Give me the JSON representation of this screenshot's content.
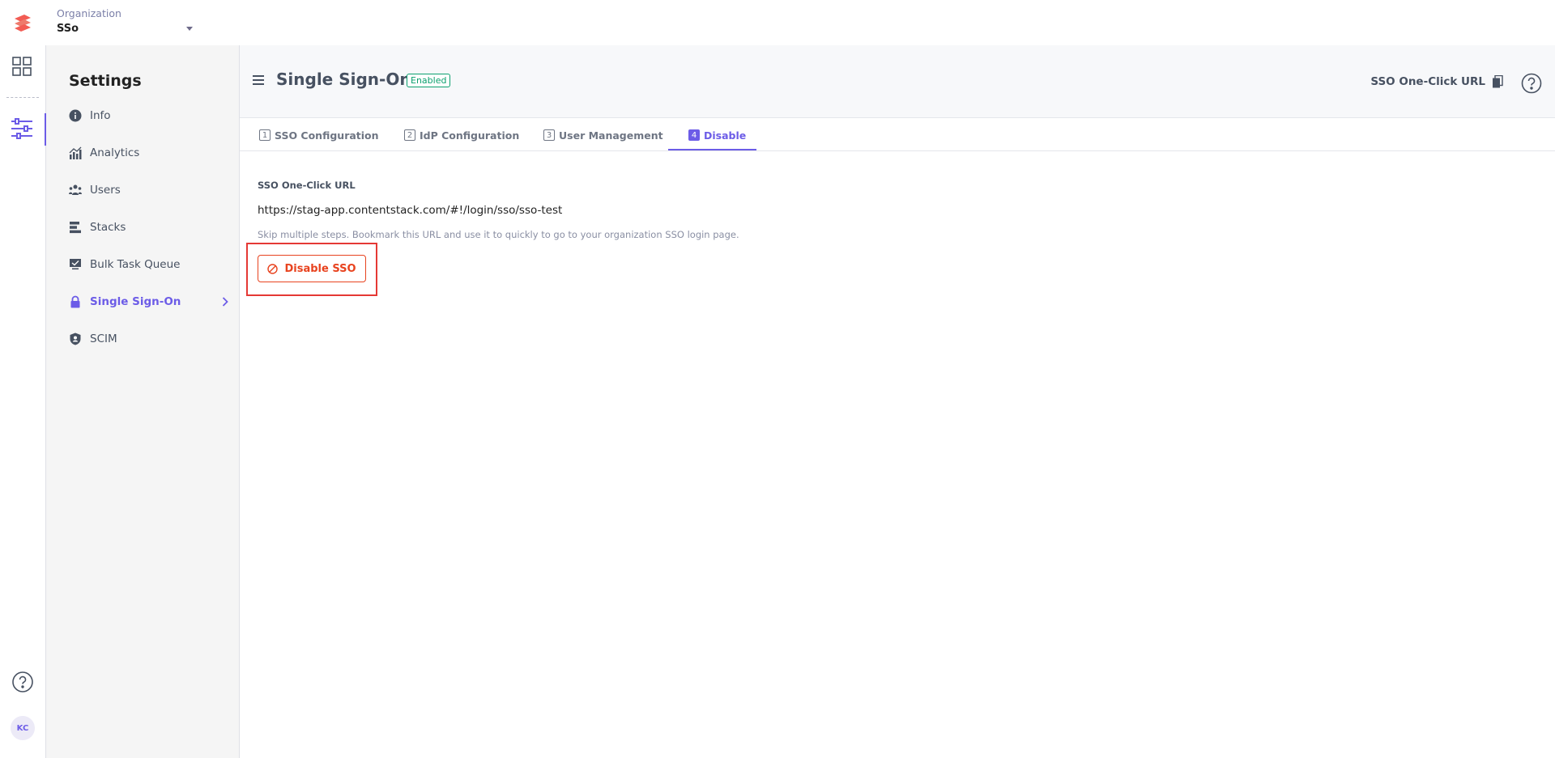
{
  "header": {
    "org_label": "Organization",
    "org_name": "SSo"
  },
  "rail": {
    "avatar_initials": "KC"
  },
  "sidebar": {
    "title": "Settings",
    "items": [
      {
        "label": "Info",
        "icon": "info-icon"
      },
      {
        "label": "Analytics",
        "icon": "analytics-icon"
      },
      {
        "label": "Users",
        "icon": "users-icon"
      },
      {
        "label": "Stacks",
        "icon": "stacks-icon"
      },
      {
        "label": "Bulk Task Queue",
        "icon": "bulk-task-icon"
      },
      {
        "label": "Single Sign-On",
        "icon": "lock-icon",
        "active": true
      },
      {
        "label": "SCIM",
        "icon": "shield-icon"
      }
    ]
  },
  "main": {
    "title": "Single Sign-On",
    "status_badge": "Enabled",
    "oneclick_link": "SSO One-Click URL",
    "tabs": [
      {
        "num": "1",
        "label": "SSO Configuration"
      },
      {
        "num": "2",
        "label": "IdP Configuration"
      },
      {
        "num": "3",
        "label": "User Management"
      },
      {
        "num": "4",
        "label": "Disable",
        "active": true
      }
    ],
    "section_label": "SSO One-Click URL",
    "url": "https://stag-app.contentstack.com/#!/login/sso/sso-test",
    "help_text": "Skip multiple steps. Bookmark this URL and use it to quickly to go to your organization SSO login page.",
    "disable_button": "Disable SSO"
  },
  "colors": {
    "accent": "#6c5ce7",
    "danger": "#e8431f",
    "success": "#0ba06e",
    "highlight": "#e53935"
  }
}
